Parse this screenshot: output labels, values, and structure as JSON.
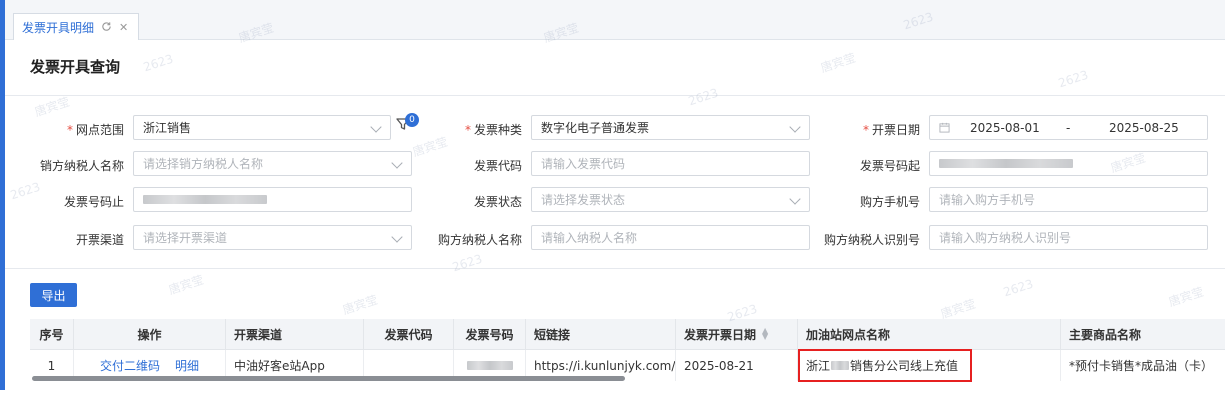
{
  "tab": {
    "title": "发票开具明细"
  },
  "page": {
    "title": "发票开具查询"
  },
  "form": {
    "station_range": {
      "label": "网点范围",
      "value": "浙江销售"
    },
    "filter_badge": "0",
    "invoice_type": {
      "label": "发票种类",
      "value": "数字化电子普通发票"
    },
    "issue_date": {
      "label": "开票日期",
      "start": "2025-08-01",
      "sep": "-",
      "end": "2025-08-25"
    },
    "seller_name": {
      "label": "销方纳税人名称",
      "placeholder": "请选择销方纳税人名称"
    },
    "invoice_code": {
      "label": "发票代码",
      "placeholder": "请输入发票代码"
    },
    "invoice_no_start": {
      "label": "发票号码起"
    },
    "invoice_no_end": {
      "label": "发票号码止"
    },
    "invoice_status": {
      "label": "发票状态",
      "placeholder": "请选择发票状态"
    },
    "buyer_phone": {
      "label": "购方手机号",
      "placeholder": "请输入购方手机号"
    },
    "channel": {
      "label": "开票渠道",
      "placeholder": "请选择开票渠道"
    },
    "buyer_name": {
      "label": "购方纳税人名称",
      "placeholder": "请输入纳税人名称"
    },
    "buyer_tax_id": {
      "label": "购方纳税人识别号",
      "placeholder": "请输入购方纳税人识别号"
    }
  },
  "toolbar": {
    "export_label": "导出"
  },
  "table": {
    "headers": {
      "seq": "序号",
      "action": "操作",
      "channel": "开票渠道",
      "code": "发票代码",
      "number": "发票号码",
      "short_link": "短链接",
      "date": "发票开票日期",
      "station": "加油站网点名称",
      "goods": "主要商品名称"
    },
    "rows": [
      {
        "seq": "1",
        "action_qr": "交付二维码",
        "action_detail": "明细",
        "channel": "中油好客e站App",
        "code": "",
        "short_link": "https://i.kunlunjyk.com/p...",
        "date": "2025-08-21",
        "station_prefix": "浙江",
        "station_suffix": "销售分公司线上充值",
        "goods": "*预付卡销售*成品油（卡）"
      }
    ]
  },
  "watermark": {
    "name": "唐宾莹",
    "code": "2623"
  }
}
